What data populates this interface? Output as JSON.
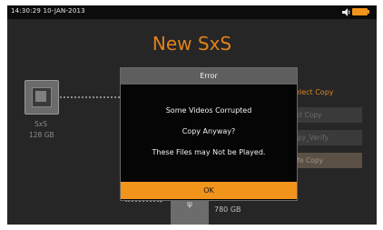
{
  "status_bar": {
    "datetime": "14:30:29 10-JAN-2013"
  },
  "title": "New SxS",
  "source_device": {
    "label": "SxS",
    "capacity": "128 GB"
  },
  "copy_panel": {
    "heading": "Select Copy",
    "options": [
      "Fast Copy",
      "Copy_Verify",
      "Safe Copy"
    ],
    "selected": "Safe Copy"
  },
  "target_drive": {
    "capacity": "780 GB"
  },
  "dialog": {
    "title": "Error",
    "message": "Some Videos Corrupted",
    "question": "Copy Anyway?",
    "warning": "These Files may Not be Played.",
    "ok_label": "OK"
  },
  "colors": {
    "accent": "#f2941c",
    "background": "#262626"
  },
  "icons": [
    "speaker-icon",
    "battery-icon",
    "sxs-card-icon",
    "usb-drive-icon"
  ]
}
